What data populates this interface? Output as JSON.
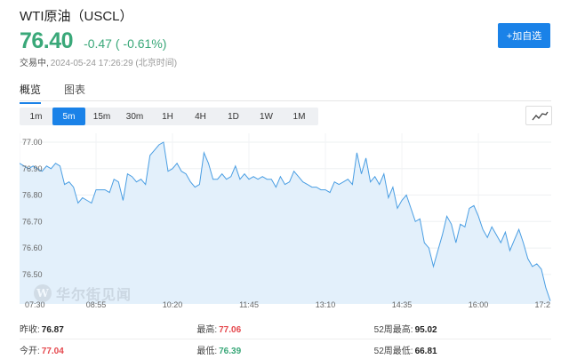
{
  "header": {
    "title": "WTI原油（USCL）",
    "price": "76.40",
    "change": "-0.47 ( -0.61%)",
    "status_label": "交易中,",
    "timestamp": "2024-05-24 17:26:29 (北京时间)",
    "add_button": "+加自选"
  },
  "tabs": [
    {
      "label": "概览",
      "active": true
    },
    {
      "label": "图表",
      "active": false
    }
  ],
  "periods": [
    {
      "label": "1m",
      "active": false
    },
    {
      "label": "5m",
      "active": true
    },
    {
      "label": "15m",
      "active": false
    },
    {
      "label": "30m",
      "active": false
    },
    {
      "label": "1H",
      "active": false
    },
    {
      "label": "4H",
      "active": false
    },
    {
      "label": "1D",
      "active": false
    },
    {
      "label": "1W",
      "active": false
    },
    {
      "label": "1M",
      "active": false
    }
  ],
  "chart_toggle_icon": "line-chart-icon",
  "chart_data": {
    "type": "area",
    "ylim": [
      76.4,
      77.0
    ],
    "yticks": [
      "77.00",
      "76.90",
      "76.80",
      "76.70",
      "76.60",
      "76.50"
    ],
    "xlabels": [
      "07:30",
      "08:55",
      "10:20",
      "11:45",
      "13:10",
      "14:35",
      "16:00",
      "17:2"
    ],
    "xlabel_positions": [
      0,
      17,
      34,
      51,
      68,
      85,
      102,
      119
    ],
    "values": [
      76.92,
      76.91,
      76.9,
      76.91,
      76.9,
      76.89,
      76.91,
      76.9,
      76.92,
      76.91,
      76.84,
      76.85,
      76.83,
      76.77,
      76.79,
      76.78,
      76.77,
      76.82,
      76.82,
      76.82,
      76.81,
      76.86,
      76.85,
      76.78,
      76.88,
      76.87,
      76.85,
      76.86,
      76.84,
      76.95,
      76.97,
      76.99,
      77.0,
      76.89,
      76.9,
      76.92,
      76.89,
      76.88,
      76.85,
      76.83,
      76.84,
      76.96,
      76.92,
      76.86,
      76.86,
      76.88,
      76.86,
      76.87,
      76.91,
      76.86,
      76.88,
      76.86,
      76.87,
      76.86,
      76.87,
      76.86,
      76.86,
      76.83,
      76.87,
      76.84,
      76.85,
      76.89,
      76.87,
      76.85,
      76.84,
      76.83,
      76.83,
      76.82,
      76.82,
      76.81,
      76.85,
      76.84,
      76.85,
      76.86,
      76.84,
      76.96,
      76.88,
      76.94,
      76.85,
      76.87,
      76.84,
      76.88,
      76.79,
      76.83,
      76.75,
      76.78,
      76.8,
      76.75,
      76.7,
      76.71,
      76.62,
      76.6,
      76.53,
      76.59,
      76.65,
      76.72,
      76.69,
      76.62,
      76.69,
      76.68,
      76.75,
      76.76,
      76.72,
      76.67,
      76.64,
      76.68,
      76.65,
      76.62,
      76.66,
      76.59,
      76.63,
      76.67,
      76.62,
      76.56,
      76.53,
      76.54,
      76.52,
      76.45,
      76.4
    ],
    "line_color": "#4a9ee3",
    "fill_color": "#e3f0fb",
    "grid": true
  },
  "watermark": {
    "logo_letter": "W",
    "text": "华尔街见闻"
  },
  "stats": [
    [
      {
        "label": "昨收:",
        "value": "76.87",
        "tone": "normal"
      },
      {
        "label": "最高:",
        "value": "77.06",
        "tone": "red"
      },
      {
        "label": "52周最高:",
        "value": "95.02",
        "tone": "normal"
      }
    ],
    [
      {
        "label": "今开:",
        "value": "77.04",
        "tone": "red"
      },
      {
        "label": "最低:",
        "value": "76.39",
        "tone": "green"
      },
      {
        "label": "52周最低:",
        "value": "66.81",
        "tone": "normal"
      }
    ]
  ],
  "colors": {
    "accent": "#1a82e8",
    "up": "#e5484d",
    "down": "#3aa879"
  }
}
